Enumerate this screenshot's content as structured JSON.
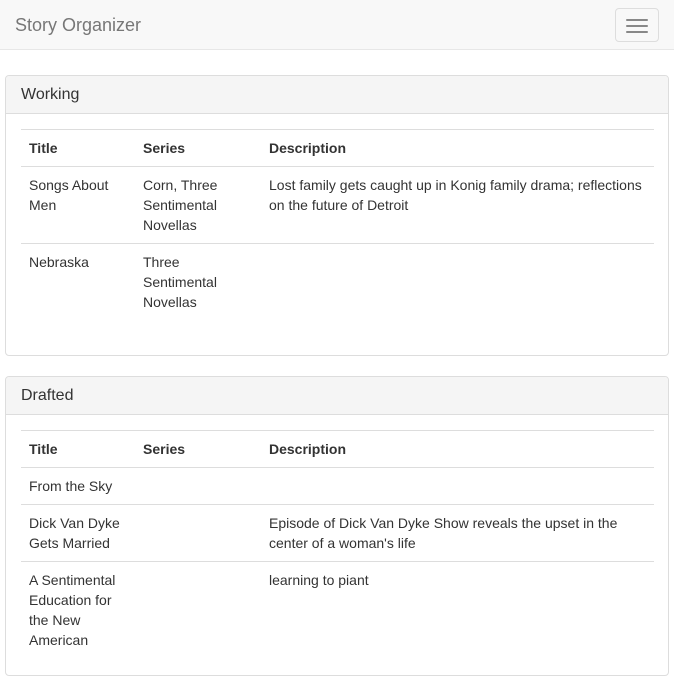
{
  "navbar": {
    "brand": "Story Organizer",
    "toggle_icon": "hamburger-menu-icon"
  },
  "panels": [
    {
      "heading": "Working",
      "columns": [
        "Title",
        "Series",
        "Description"
      ],
      "rows": [
        {
          "title": "Songs About Men",
          "series": "Corn, Three Sentimental Novellas",
          "description": "Lost family gets caught up in Konig family drama; reflections on the future of Detroit"
        },
        {
          "title": "Nebraska",
          "series": "Three Sentimental Novellas",
          "description": ""
        }
      ]
    },
    {
      "heading": "Drafted",
      "columns": [
        "Title",
        "Series",
        "Description"
      ],
      "rows": [
        {
          "title": "From the Sky",
          "series": "",
          "description": ""
        },
        {
          "title": "Dick Van Dyke Gets Married",
          "series": "",
          "description": "Episode of Dick Van Dyke Show reveals the upset in the center of a woman's life"
        },
        {
          "title": "A Sentimental Education for the New American",
          "series": "",
          "description": "learning to piant"
        }
      ]
    }
  ]
}
